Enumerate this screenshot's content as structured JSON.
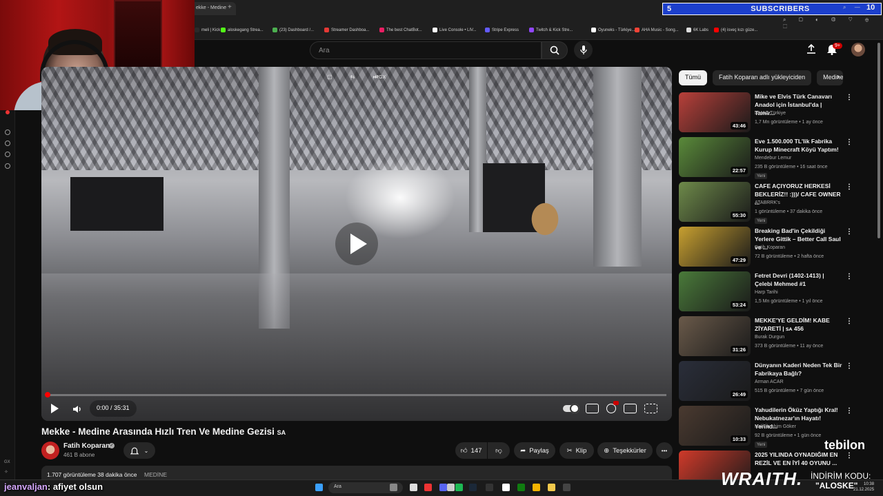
{
  "browser": {
    "active_tab_title": "ekke - Medine",
    "new_tab_label": "+",
    "bookmarks": [
      {
        "label": "meli | Kick",
        "color": "#2a2a2a"
      },
      {
        "label": "aloskegang Strea...",
        "color": "#53fc18"
      },
      {
        "label": "(23) Dashboard /...",
        "color": "#4caf50"
      },
      {
        "label": "Streamer Dashboa...",
        "color": "#e53935"
      },
      {
        "label": "The best ChatBot...",
        "color": "#e91e63"
      },
      {
        "label": "Live Console • LIV...",
        "color": "#ffffff"
      },
      {
        "label": "Stripe Express",
        "color": "#635bff"
      },
      {
        "label": "Twitch & Kick Stre...",
        "color": "#9146ff"
      },
      {
        "label": "Oyuneks - Türkiye...",
        "color": "#ffffff"
      },
      {
        "label": "AHA Music - Song...",
        "color": "#f44336"
      },
      {
        "label": "6K Labs",
        "color": "#dddddd"
      },
      {
        "label": "(4) isveç kızı güze...",
        "color": "#ff0000"
      }
    ]
  },
  "overlay": {
    "subs_count_left": "5",
    "subs_label": "SUBSCRIBERS",
    "subs_goal": "10",
    "tebilon": "tebilon",
    "wraith": "WRAITH.",
    "indirim": "İNDİRİM KODU:",
    "code": "\"ALOSKE\""
  },
  "header": {
    "search_placeholder": "Ara",
    "notif_count": "9+"
  },
  "player": {
    "time": "0:00 / 35:31",
    "progress": 0,
    "top_label": "RGX"
  },
  "video": {
    "title": "Mekke - Medine Arasında Hızlı Tren Ve Medine Gezisi",
    "title_suffix": "SA",
    "channel": "Fatih Koparan",
    "subs": "461 B abone",
    "likes": "147",
    "share": "Paylaş",
    "clip": "Klip",
    "thanks": "Teşekkürler",
    "more": "•••",
    "desc_stats": "1.707 görüntüleme  38 dakika önce",
    "desc_tag": "MEDİNE"
  },
  "sidebar": {
    "chips": [
      "Tümü",
      "Fatih Koparan adlı yükleyiciden",
      "Medine"
    ],
    "recs": [
      {
        "title": "Mike ve Elvis Türk Canavarı Anadol için İstanbul'da | Tamir...",
        "channel": "DMAX Türkiye",
        "meta": "1,7 Mn görüntüleme • 1 ay önce",
        "duration": "43:46",
        "new": "",
        "thumb": "#b8403a"
      },
      {
        "title": "Eve 1.500.000 TL'lik Fabrika Kurup Minecraft Köyü Yaptım!",
        "channel": "Mendebur Lemur",
        "meta": "235 B görüntüleme • 16 saat önce",
        "duration": "22:57",
        "new": "Yeni",
        "thumb": "#5a8a3a"
      },
      {
        "title": "CAFE AÇIYORUZ HERKESİ BEKLERİZ!! :)))/ CAFE OWNER ...",
        "channel": "ATABRRK's",
        "meta": "1 görüntüleme • 37 dakika önce",
        "duration": "55:30",
        "new": "Yeni",
        "thumb": "#6e8a4a"
      },
      {
        "title": "Breaking Bad'in Çekildiği Yerlere Gittik – Better Call Saul ve ...",
        "channel": "Fatih Koparan",
        "meta": "72 B görüntüleme • 2 hafta önce",
        "duration": "47:29",
        "new": "",
        "thumb": "#c8a030"
      },
      {
        "title": "Fetret Devri (1402-1413) | Çelebi Mehmed #1",
        "channel": "Harp Tarihi",
        "meta": "1,5 Mn görüntüleme • 1 yıl önce",
        "duration": "53:24",
        "new": "",
        "thumb": "#4a7a3a"
      },
      {
        "title": "MEKKE'YE GELDİM! KABE ZİYARETİ | ꜱᴀ 456",
        "channel": "Burak Durgun",
        "meta": "373 B görüntüleme • 11 ay önce",
        "duration": "31:26",
        "new": "",
        "thumb": "#6a5a4a"
      },
      {
        "title": "Dünyanın Kaderi Neden Tek Bir Fabrikaya Bağlı?",
        "channel": "Arman ACAR",
        "meta": "515 B görüntüleme • 7 gün önce",
        "duration": "26:49",
        "new": "",
        "thumb": "#2a2e3a"
      },
      {
        "title": "Yahudilerin Öküz Yaptığı Kral! Nebukatnezar'ın Hayatı! Yerind...",
        "channel": "Halil İbrahim Göker",
        "meta": "92 B görüntüleme • 1 gün önce",
        "duration": "10:33",
        "new": "Yeni",
        "thumb": "#4a3a30"
      },
      {
        "title": "2025 YILINDA OYNADIĞIM EN REZİL VE EN İYİ 40 OYUNU ...",
        "channel": "",
        "meta": "",
        "duration": "",
        "new": "",
        "thumb": "#d03a2a"
      }
    ]
  },
  "taskbar": {
    "search": "Ara",
    "time": "10:38",
    "date": "21.12.2025"
  },
  "chat": {
    "user": "jeanvaljan",
    "message": ": afiyet olsun"
  },
  "dock": {
    "gx": "GX"
  }
}
